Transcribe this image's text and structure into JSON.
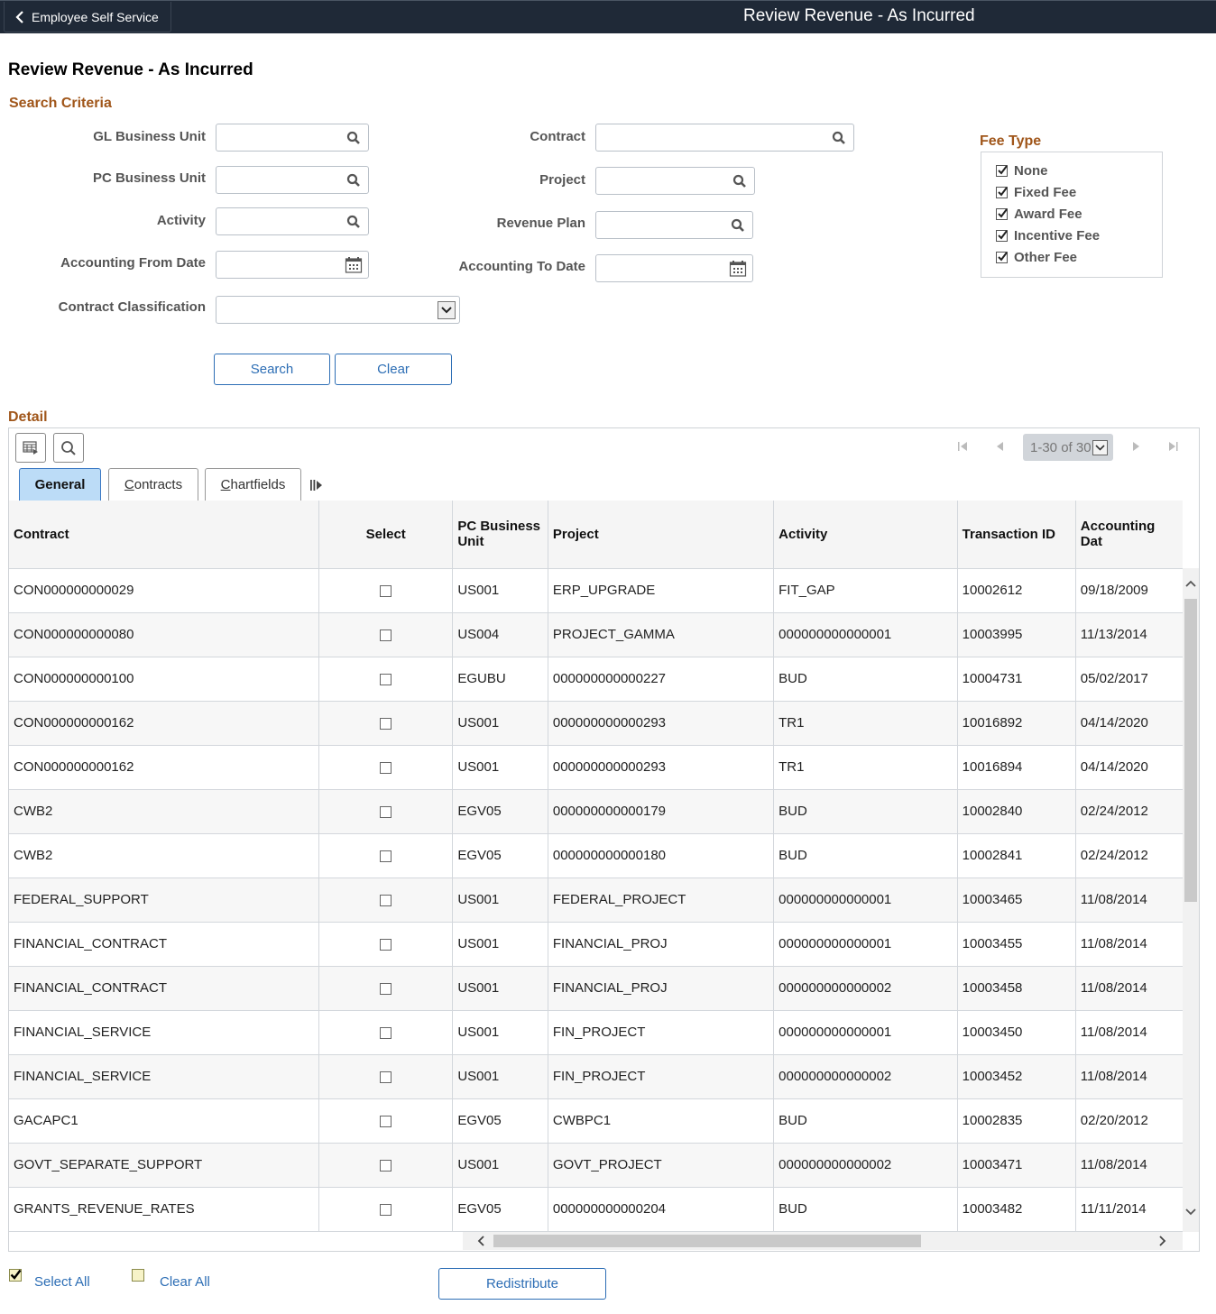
{
  "banner": {
    "back_label": "Employee Self Service",
    "title": "Review Revenue - As Incurred"
  },
  "page_title": "Review Revenue - As Incurred",
  "search_criteria": {
    "section_title": "Search Criteria",
    "fields": {
      "gl_business_unit": {
        "label": "GL Business Unit",
        "value": ""
      },
      "pc_business_unit": {
        "label": "PC Business Unit",
        "value": ""
      },
      "activity": {
        "label": "Activity",
        "value": ""
      },
      "accounting_from_date": {
        "label": "Accounting From Date",
        "value": ""
      },
      "contract_classification": {
        "label": "Contract Classification",
        "value": ""
      },
      "contract": {
        "label": "Contract",
        "value": ""
      },
      "project": {
        "label": "Project",
        "value": ""
      },
      "revenue_plan": {
        "label": "Revenue Plan",
        "value": ""
      },
      "accounting_to_date": {
        "label": "Accounting To Date",
        "value": ""
      }
    },
    "search_label": "Search",
    "clear_label": "Clear"
  },
  "fee_type": {
    "title": "Fee Type",
    "options": [
      {
        "label": "None",
        "checked": true
      },
      {
        "label": "Fixed Fee",
        "checked": true
      },
      {
        "label": "Award Fee",
        "checked": true
      },
      {
        "label": "Incentive Fee",
        "checked": true
      },
      {
        "label": "Other Fee",
        "checked": true
      }
    ]
  },
  "detail": {
    "section_title": "Detail",
    "pager": "1-30 of 30",
    "tabs": [
      {
        "label": "General",
        "active": true
      },
      {
        "label": "Contracts",
        "active": false
      },
      {
        "label": "Chartfields",
        "active": false
      }
    ],
    "columns": [
      "Contract",
      "Select",
      "PC Business Unit",
      "Project",
      "Activity",
      "Transaction ID",
      "Accounting Dat"
    ],
    "rows": [
      {
        "contract": "CON000000000029",
        "selected": false,
        "pc_bu": "US001",
        "project": "ERP_UPGRADE",
        "activity": "FIT_GAP",
        "txn_id": "10002612",
        "acct_date": "09/18/2009"
      },
      {
        "contract": "CON000000000080",
        "selected": false,
        "pc_bu": "US004",
        "project": "PROJECT_GAMMA",
        "activity": "000000000000001",
        "txn_id": "10003995",
        "acct_date": "11/13/2014"
      },
      {
        "contract": "CON000000000100",
        "selected": false,
        "pc_bu": "EGUBU",
        "project": "000000000000227",
        "activity": "BUD",
        "txn_id": "10004731",
        "acct_date": "05/02/2017"
      },
      {
        "contract": "CON000000000162",
        "selected": false,
        "pc_bu": "US001",
        "project": "000000000000293",
        "activity": "TR1",
        "txn_id": "10016892",
        "acct_date": "04/14/2020"
      },
      {
        "contract": "CON000000000162",
        "selected": false,
        "pc_bu": "US001",
        "project": "000000000000293",
        "activity": "TR1",
        "txn_id": "10016894",
        "acct_date": "04/14/2020"
      },
      {
        "contract": "CWB2",
        "selected": false,
        "pc_bu": "EGV05",
        "project": "000000000000179",
        "activity": "BUD",
        "txn_id": "10002840",
        "acct_date": "02/24/2012"
      },
      {
        "contract": "CWB2",
        "selected": false,
        "pc_bu": "EGV05",
        "project": "000000000000180",
        "activity": "BUD",
        "txn_id": "10002841",
        "acct_date": "02/24/2012"
      },
      {
        "contract": "FEDERAL_SUPPORT",
        "selected": false,
        "pc_bu": "US001",
        "project": "FEDERAL_PROJECT",
        "activity": "000000000000001",
        "txn_id": "10003465",
        "acct_date": "11/08/2014"
      },
      {
        "contract": "FINANCIAL_CONTRACT",
        "selected": false,
        "pc_bu": "US001",
        "project": "FINANCIAL_PROJ",
        "activity": "000000000000001",
        "txn_id": "10003455",
        "acct_date": "11/08/2014"
      },
      {
        "contract": "FINANCIAL_CONTRACT",
        "selected": false,
        "pc_bu": "US001",
        "project": "FINANCIAL_PROJ",
        "activity": "000000000000002",
        "txn_id": "10003458",
        "acct_date": "11/08/2014"
      },
      {
        "contract": "FINANCIAL_SERVICE",
        "selected": false,
        "pc_bu": "US001",
        "project": "FIN_PROJECT",
        "activity": "000000000000001",
        "txn_id": "10003450",
        "acct_date": "11/08/2014"
      },
      {
        "contract": "FINANCIAL_SERVICE",
        "selected": false,
        "pc_bu": "US001",
        "project": "FIN_PROJECT",
        "activity": "000000000000002",
        "txn_id": "10003452",
        "acct_date": "11/08/2014"
      },
      {
        "contract": "GACAPC1",
        "selected": false,
        "pc_bu": "EGV05",
        "project": "CWBPC1",
        "activity": "BUD",
        "txn_id": "10002835",
        "acct_date": "02/20/2012"
      },
      {
        "contract": "GOVT_SEPARATE_SUPPORT",
        "selected": false,
        "pc_bu": "US001",
        "project": "GOVT_PROJECT",
        "activity": "000000000000002",
        "txn_id": "10003471",
        "acct_date": "11/08/2014"
      },
      {
        "contract": "GRANTS_REVENUE_RATES",
        "selected": false,
        "pc_bu": "EGV05",
        "project": "000000000000204",
        "activity": "BUD",
        "txn_id": "10003482",
        "acct_date": "11/11/2014"
      },
      {
        "contract": "",
        "selected": false,
        "pc_bu": "",
        "project": "",
        "activity": "",
        "txn_id": "",
        "acct_date": ""
      }
    ]
  },
  "footer": {
    "select_all_label": "Select All",
    "clear_all_label": "Clear All",
    "redistribute_label": "Redistribute"
  }
}
